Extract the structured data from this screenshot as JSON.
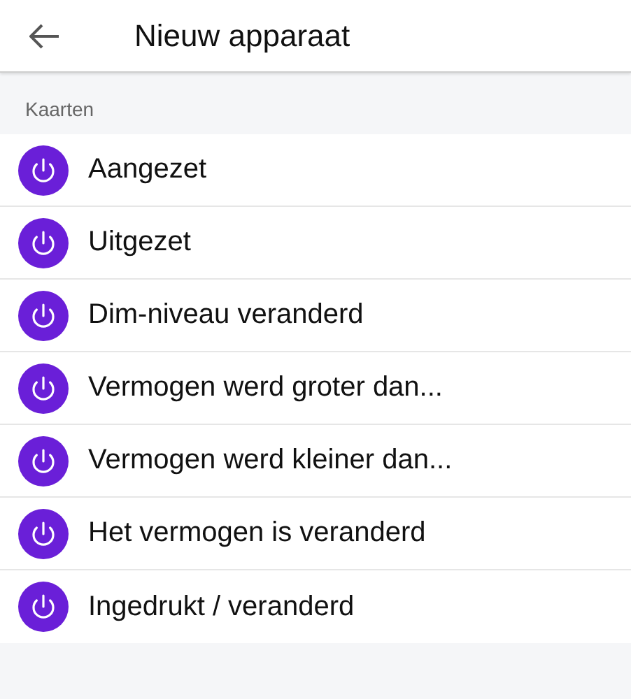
{
  "header": {
    "title": "Nieuw apparaat"
  },
  "section": {
    "title": "Kaarten",
    "items": [
      {
        "label": "Aangezet"
      },
      {
        "label": "Uitgezet"
      },
      {
        "label": "Dim-niveau veranderd"
      },
      {
        "label": "Vermogen werd groter dan..."
      },
      {
        "label": "Vermogen werd kleiner dan..."
      },
      {
        "label": "Het vermogen is veranderd"
      },
      {
        "label": "Ingedrukt / veranderd"
      }
    ]
  }
}
